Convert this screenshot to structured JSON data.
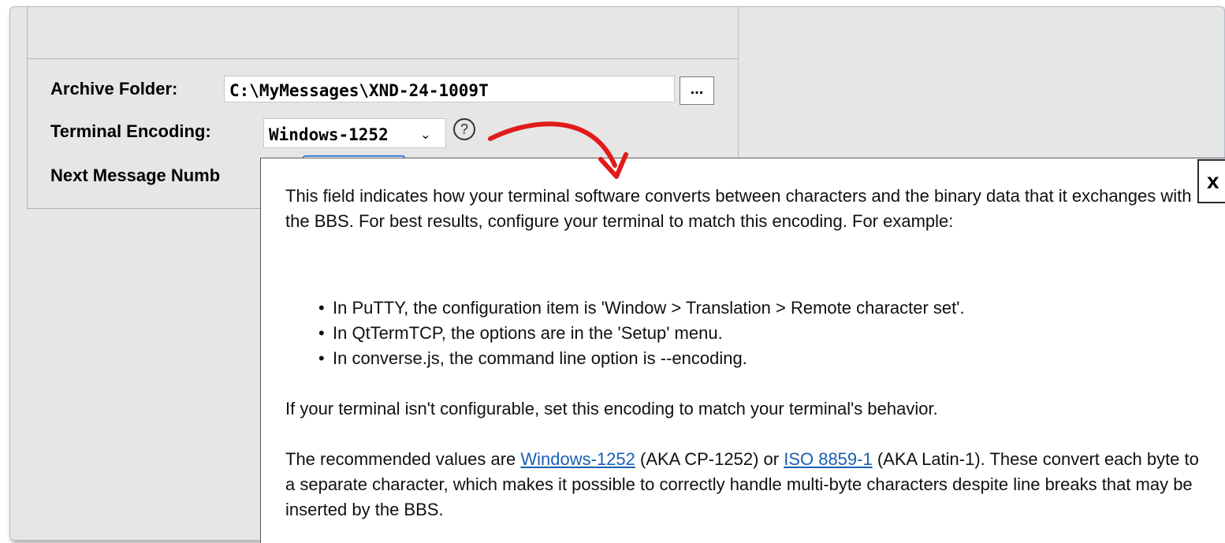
{
  "form": {
    "archive_label": "Archive Folder:",
    "archive_value": "C:\\MyMessages\\XND-24-1009T",
    "browse_label": "...",
    "encoding_label": "Terminal Encoding:",
    "encoding_value": "Windows-1252",
    "encoding_chevron": "⌄",
    "help_label": "?",
    "next_number_label": "Next Message Numb"
  },
  "popup": {
    "close_label": "x",
    "para1": "This field indicates how your terminal software converts between characters and the binary data that it exchanges with the BBS. For best results, configure your terminal to match this encoding. For example:",
    "bullets": [
      "In PuTTY, the configuration item is 'Window > Translation > Remote character set'.",
      "In QtTermTCP, the options are in the 'Setup' menu.",
      "In converse.js, the command line option is --encoding."
    ],
    "para2": "If your terminal isn't configurable, set this encoding to match your terminal's behavior.",
    "para3_prefix": "The recommended values are ",
    "link1": "Windows-1252",
    "para3_mid": " (AKA CP-1252) or ",
    "link2": "ISO 8859-1",
    "para3_suffix": " (AKA Latin-1). These convert each byte to a separate character, which makes it possible to correctly handle multi-byte characters despite line breaks that may be inserted by the BBS."
  },
  "colors": {
    "link": "#1a5fb4",
    "annotation_arrow": "#e11a1a",
    "focus_border": "#3b7bd9"
  }
}
